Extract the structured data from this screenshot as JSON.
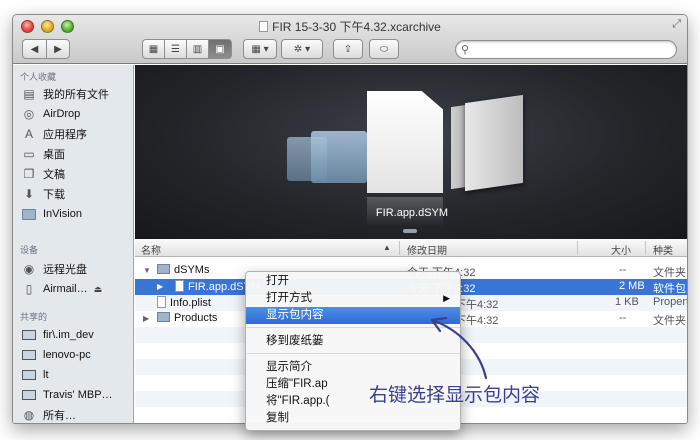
{
  "window": {
    "title": "FIR 15-3-30 下午4.32.xcarchive"
  },
  "toolbar": {
    "back_icon": "chevron-left-icon",
    "forward_icon": "chevron-right-icon",
    "view_modes": [
      "icon-view-icon",
      "list-view-icon",
      "column-view-icon",
      "coverflow-view-icon"
    ],
    "active_view": "coverflow-view-icon",
    "search_placeholder": ""
  },
  "sidebar": {
    "sections": [
      {
        "title": "个人收藏",
        "items": [
          {
            "label": "我的所有文件",
            "icon": "all-files-icon"
          },
          {
            "label": "AirDrop",
            "icon": "airdrop-icon"
          },
          {
            "label": "应用程序",
            "icon": "applications-icon"
          },
          {
            "label": "桌面",
            "icon": "desktop-icon"
          },
          {
            "label": "文稿",
            "icon": "documents-icon"
          },
          {
            "label": "下载",
            "icon": "downloads-icon"
          },
          {
            "label": "InVision",
            "icon": "folder-icon"
          }
        ]
      },
      {
        "title": "设备",
        "items": [
          {
            "label": "远程光盘",
            "icon": "disc-icon"
          },
          {
            "label": "Airmail…",
            "icon": "drive-icon"
          }
        ]
      },
      {
        "title": "共享的",
        "items": [
          {
            "label": "fir\\.im_dev",
            "icon": "monitor-icon"
          },
          {
            "label": "lenovo-pc",
            "icon": "monitor-icon"
          },
          {
            "label": "lt",
            "icon": "monitor-icon"
          },
          {
            "label": "Travis' MBP…",
            "icon": "monitor-icon"
          },
          {
            "label": "所有…",
            "icon": "network-icon"
          }
        ]
      }
    ]
  },
  "coverflow": {
    "caption": "FIR.app.dSYM"
  },
  "list": {
    "headers": {
      "name": "名称",
      "date": "修改日期",
      "size": "大小",
      "kind": "种类"
    },
    "rows": [
      {
        "name": "dSYMs",
        "date": "今天 下午4:32",
        "size": "--",
        "kind": "文件夹"
      },
      {
        "name": "FIR.app.dSYM",
        "date": "今天 下午4:32",
        "size": "2 MB",
        "kind": "软件包"
      },
      {
        "name": "Info.plist",
        "date": "下午4:32",
        "size": "1 KB",
        "kind": "Propert"
      },
      {
        "name": "Products",
        "date": "下午4:32",
        "size": "--",
        "kind": "文件夹"
      }
    ]
  },
  "context_menu": {
    "items": [
      {
        "label": "打开"
      },
      {
        "label": "打开方式"
      },
      {
        "label": "显示包内容"
      },
      {
        "label": "移到废纸篓"
      },
      {
        "label": "显示简介"
      },
      {
        "label": "压缩\"FIR.ap"
      },
      {
        "label": "将\"FIR.app.("
      },
      {
        "label": "复制"
      }
    ]
  },
  "annotation": {
    "text": "右键选择显示包内容"
  },
  "colors": {
    "selection": "#3875d7",
    "annotation": "#3a3f8f",
    "sidebar_bg": "#e3e8ed"
  }
}
